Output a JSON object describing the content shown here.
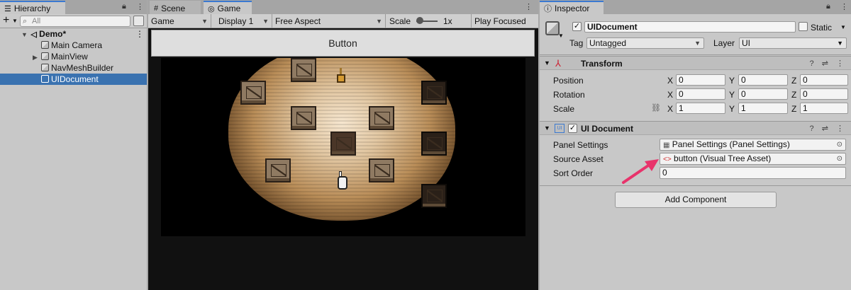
{
  "hierarchy": {
    "tab_label": "Hierarchy",
    "search_placeholder": "All",
    "items": [
      {
        "label": "Demo*"
      },
      {
        "label": "Main Camera"
      },
      {
        "label": "MainView"
      },
      {
        "label": "NavMeshBuilder"
      },
      {
        "label": "UIDocument"
      }
    ]
  },
  "game": {
    "tabs": [
      {
        "label": "Scene"
      },
      {
        "label": "Game"
      }
    ],
    "toolbar": {
      "mode": "Game",
      "display": "Display 1",
      "aspect": "Free Aspect",
      "scale_label": "Scale",
      "scale_value": "1x",
      "play_mode": "Play Focused"
    },
    "ui_button_label": "Button"
  },
  "inspector": {
    "tab_label": "Inspector",
    "object_name": "UIDocument",
    "static_label": "Static",
    "tag_label": "Tag",
    "tag_value": "Untagged",
    "layer_label": "Layer",
    "layer_value": "UI",
    "transform": {
      "title": "Transform",
      "position_label": "Position",
      "rotation_label": "Rotation",
      "scale_label": "Scale",
      "axis_labels": [
        "X",
        "Y",
        "Z"
      ],
      "position": [
        "0",
        "0",
        "0"
      ],
      "rotation": [
        "0",
        "0",
        "0"
      ],
      "scale": [
        "1",
        "1",
        "1"
      ]
    },
    "ui_document": {
      "title": "UI Document",
      "panel_settings_label": "Panel Settings",
      "panel_settings_value": "Panel Settings (Panel Settings)",
      "source_asset_label": "Source Asset",
      "source_asset_value": "button (Visual Tree Asset)",
      "sort_order_label": "Sort Order",
      "sort_order_value": "0"
    },
    "add_component_label": "Add Component"
  },
  "colors": {
    "selection": "#3a72b0",
    "tab_accent": "#3a79d1",
    "annotation_arrow": "#e8336b"
  }
}
